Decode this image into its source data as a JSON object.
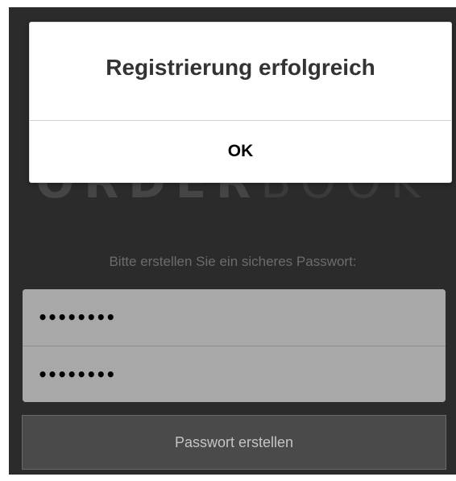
{
  "logo": {
    "bold_part": "ORDER",
    "light_part": "BOOK"
  },
  "form": {
    "prompt": "Bitte erstellen Sie ein sicheres Passwort:",
    "password_value": "••••••••",
    "password_confirm_value": "••••••••",
    "submit_label": "Passwort erstellen"
  },
  "dialog": {
    "title": "Registrierung erfolgreich",
    "ok_label": "OK"
  },
  "colors": {
    "background": "#2b2b2b",
    "field_background": "#a8a8a8",
    "button_background": "#4a4a4a",
    "dialog_background": "#ffffff"
  }
}
